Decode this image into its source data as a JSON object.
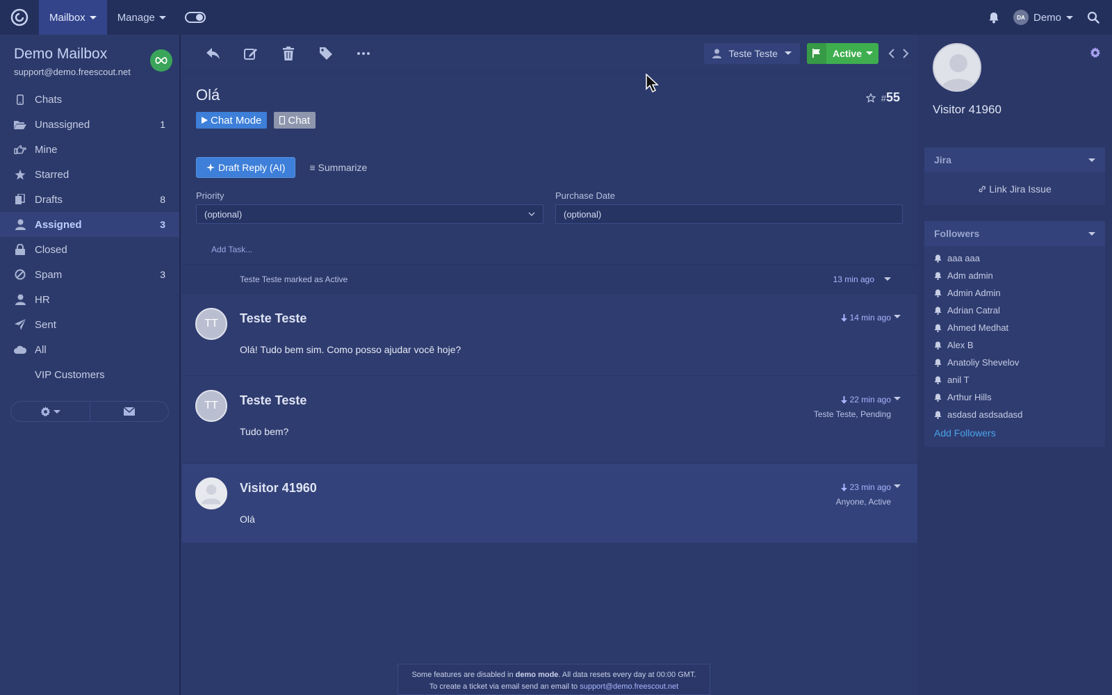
{
  "topnav": {
    "mailbox_label": "Mailbox",
    "manage_label": "Manage",
    "user_initials": "DA",
    "user_name": "Demo"
  },
  "sidebar": {
    "mailbox_name": "Demo Mailbox",
    "mailbox_email": "support@demo.freescout.net",
    "folders": [
      {
        "label": "Chats",
        "count": "",
        "icon": "mobile-icon"
      },
      {
        "label": "Unassigned",
        "count": "1",
        "icon": "folder-open-icon"
      },
      {
        "label": "Mine",
        "count": "",
        "icon": "hand-point-icon"
      },
      {
        "label": "Starred",
        "count": "",
        "icon": "star-icon"
      },
      {
        "label": "Drafts",
        "count": "8",
        "icon": "drafts-icon"
      },
      {
        "label": "Assigned",
        "count": "3",
        "icon": "user-icon"
      },
      {
        "label": "Closed",
        "count": "",
        "icon": "lock-icon"
      },
      {
        "label": "Spam",
        "count": "3",
        "icon": "ban-icon"
      },
      {
        "label": "HR",
        "count": "",
        "icon": "user-icon"
      },
      {
        "label": "Sent",
        "count": "",
        "icon": "send-icon"
      },
      {
        "label": "All",
        "count": "",
        "icon": "cloud-icon"
      },
      {
        "label": "VIP Customers",
        "count": "",
        "icon": ""
      }
    ],
    "active_folder": "Assigned"
  },
  "toolbar": {
    "assignee": "Teste Teste",
    "status": "Active",
    "status_color": "#3fae4f"
  },
  "conversation": {
    "subject": "Olá",
    "number_prefix": "#",
    "number": "55",
    "tags": [
      "Chat Mode",
      "Chat"
    ],
    "ai_button": "Draft Reply (AI)",
    "summarize_button": "Summarize",
    "fields": [
      {
        "label": "Priority",
        "value": "(optional)"
      },
      {
        "label": "Purchase Date",
        "value": "(optional)"
      }
    ],
    "add_task": "Add Task...",
    "event": {
      "text": "Teste Teste marked as Active",
      "time": "13 min ago"
    },
    "messages": [
      {
        "initials": "TT",
        "author": "Teste Teste",
        "time": "14 min ago",
        "status": "",
        "body": "Olá! Tudo bem sim. Como posso ajudar você hoje?"
      },
      {
        "initials": "TT",
        "author": "Teste Teste",
        "time": "22 min ago",
        "status": "Teste Teste, Pending",
        "body": "Tudo bem?"
      },
      {
        "initials": "",
        "author": "Visitor 41960",
        "time": "23 min ago",
        "status": "Anyone, Active",
        "body": "Olá"
      }
    ]
  },
  "demo_notice": {
    "line1_pre": "Some features are disabled in ",
    "line1_bold": "demo mode",
    "line1_post": ". All data resets every day at 00:00 GMT.",
    "line2_pre": "To create a ticket via email send an email to ",
    "line2_link": "support@demo.freescout.net"
  },
  "customer": {
    "name": "Visitor 41960",
    "jira_title": "Jira",
    "jira_link": "Link Jira Issue",
    "followers_title": "Followers",
    "followers": [
      "aaa aaa",
      "Adm admin",
      "Admin Admin",
      "Adrian Catral",
      "Ahmed Medhat",
      "Alex B",
      "Anatoliy Shevelov",
      "anil T",
      "Arthur Hills",
      "asdasd asdsadasd"
    ],
    "add_followers": "Add Followers"
  },
  "colors": {
    "accent_blue": "#3d7fd9",
    "link_blue": "#4aa3ea",
    "status_green": "#3fae4f"
  }
}
